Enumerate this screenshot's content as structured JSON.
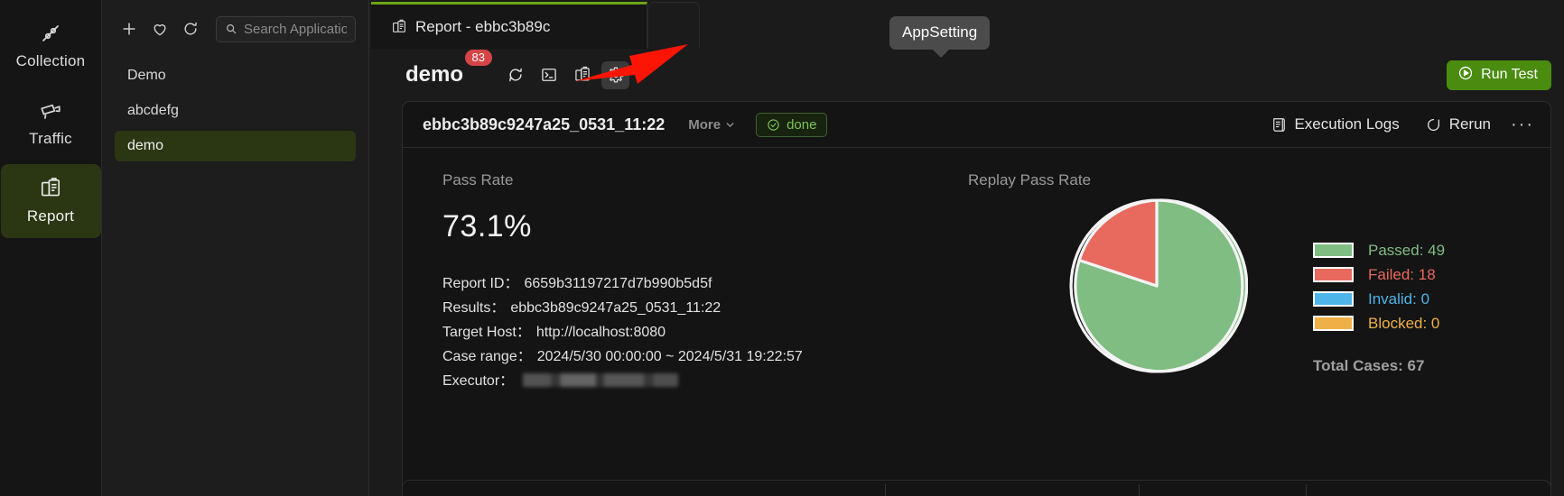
{
  "rail": {
    "items": [
      {
        "label": "Collection",
        "icon": "collection-icon",
        "active": false
      },
      {
        "label": "Traffic",
        "icon": "traffic-camera-icon",
        "active": false
      },
      {
        "label": "Report",
        "icon": "report-clipboard-icon",
        "active": true
      }
    ]
  },
  "applist": {
    "toolbar": {
      "add": "plus-icon",
      "favorite": "heart-icon",
      "refresh": "refresh-icon"
    },
    "search": {
      "placeholder": "Search Applicatio...",
      "value": ""
    },
    "items": [
      {
        "label": "Demo",
        "selected": false
      },
      {
        "label": "abcdefg",
        "selected": false
      },
      {
        "label": "demo",
        "selected": true
      }
    ]
  },
  "tabs": [
    {
      "label": "Report - ebbc3b89c",
      "icon": "report-clipboard-icon",
      "active": true
    }
  ],
  "tooltip": {
    "text": "AppSetting"
  },
  "app_header": {
    "title": "demo",
    "badge_count": "83",
    "actions": [
      {
        "name": "refresh-icon",
        "active": false
      },
      {
        "name": "terminal-icon",
        "active": false
      },
      {
        "name": "report-clipboard-icon",
        "active": false
      },
      {
        "name": "gear-icon",
        "active": true
      }
    ],
    "run_button": "Run Test"
  },
  "report": {
    "id_title": "ebbc3b89c9247a25_0531_11:22",
    "more_label": "More",
    "status": "done",
    "execution_logs_label": "Execution Logs",
    "rerun_label": "Rerun",
    "overflow_label": "···",
    "pass_rate_label": "Pass Rate",
    "pass_rate_value": "73.1%",
    "replay_pass_rate_label": "Replay Pass Rate",
    "details": [
      {
        "key": "Report ID：",
        "value": "6659b31197217d7b990b5d5f"
      },
      {
        "key": "Results：",
        "value": "ebbc3b89c9247a25_0531_11:22"
      },
      {
        "key": "Target Host：",
        "value": "http://localhost:8080"
      },
      {
        "key": "Case range：",
        "value": "2024/5/30 00:00:00 ~ 2024/5/31 19:22:57"
      },
      {
        "key": "Executor：",
        "value": "",
        "redacted": true
      }
    ]
  },
  "chart_data": {
    "type": "pie",
    "title": "Replay Pass Rate",
    "categories": [
      "Passed",
      "Failed",
      "Invalid",
      "Blocked"
    ],
    "values": [
      49,
      18,
      0,
      0
    ],
    "colors": [
      "#7fbd82",
      "#e8695e",
      "#4db5e8",
      "#eeb047"
    ],
    "legend_position": "right",
    "legend": [
      {
        "label": "Passed: 49",
        "color": "#7fbd82"
      },
      {
        "label": "Failed: 18",
        "color": "#e8695e"
      },
      {
        "label": "Invalid: 0",
        "color": "#4db5e8"
      },
      {
        "label": "Blocked: 0",
        "color": "#eeb047"
      }
    ],
    "total_label": "Total Cases: 67",
    "total": 67,
    "pass_rate_pct": 73.1
  },
  "colors": {
    "accent_green": "#4a8c10",
    "tab_accent": "#6aa516",
    "active_nav_bg": "#2b3712",
    "badge_red": "#d64545",
    "tooltip_bg": "#4b4b4b",
    "annotation_arrow": "#fc1505"
  }
}
